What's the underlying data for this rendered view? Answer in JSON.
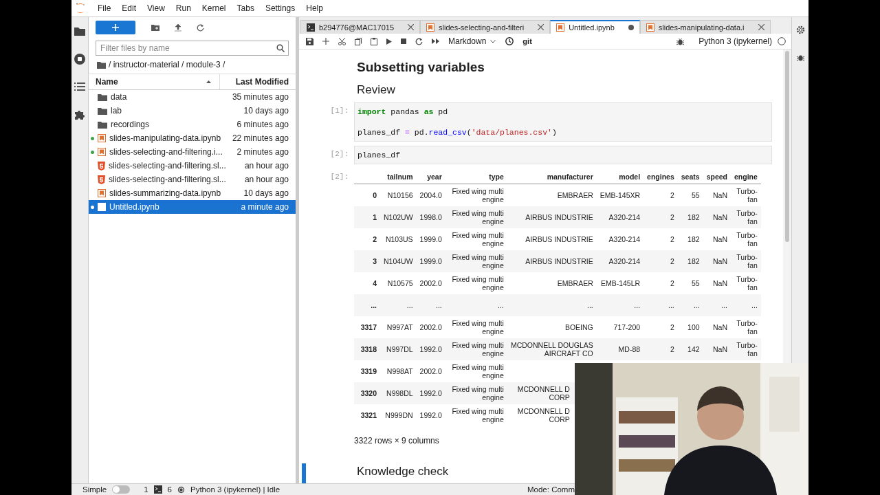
{
  "menu": [
    "File",
    "Edit",
    "View",
    "Run",
    "Kernel",
    "Tabs",
    "Settings",
    "Help"
  ],
  "file_browser": {
    "filter": {
      "placeholder": "Filter files by name"
    },
    "path": "/ instructor-material / module-3 /",
    "columns": [
      "Name",
      "Last Modified"
    ],
    "items": [
      {
        "name": "data",
        "modified": "35 minutes ago",
        "kind": "folder",
        "running": false,
        "selected": false
      },
      {
        "name": "lab",
        "modified": "10 days ago",
        "kind": "folder",
        "running": false,
        "selected": false
      },
      {
        "name": "recordings",
        "modified": "6 minutes ago",
        "kind": "folder",
        "running": false,
        "selected": false
      },
      {
        "name": "slides-manipulating-data.ipynb",
        "modified": "22 minutes ago",
        "kind": "notebook",
        "running": true,
        "selected": false
      },
      {
        "name": "slides-selecting-and-filtering.i...",
        "modified": "2 minutes ago",
        "kind": "notebook",
        "running": true,
        "selected": false
      },
      {
        "name": "slides-selecting-and-filtering.sl...",
        "modified": "an hour ago",
        "kind": "html",
        "running": false,
        "selected": false
      },
      {
        "name": "slides-selecting-and-filtering.sl...",
        "modified": "an hour ago",
        "kind": "html",
        "running": false,
        "selected": false
      },
      {
        "name": "slides-summarizing-data.ipynb",
        "modified": "10 days ago",
        "kind": "notebook",
        "running": false,
        "selected": false
      },
      {
        "name": "Untitled.ipynb",
        "modified": "a minute ago",
        "kind": "notebook",
        "running": true,
        "selected": true
      }
    ]
  },
  "tabs": [
    {
      "label": "b294776@MAC17015",
      "kind": "terminal",
      "selected": false,
      "modified": false
    },
    {
      "label": "slides-selecting-and-filteri",
      "kind": "notebook",
      "selected": false,
      "modified": false
    },
    {
      "label": "Untitled.ipynb",
      "kind": "notebook",
      "selected": true,
      "modified": true
    },
    {
      "label": "slides-manipulating-data.i",
      "kind": "notebook",
      "selected": false,
      "modified": false
    }
  ],
  "toolbar": {
    "cell_type": "Markdown",
    "git": "git",
    "kernel": "Python 3 (ipykernel)"
  },
  "notebook": {
    "cells": [
      {
        "kind": "heading1",
        "text": "Subsetting variables"
      },
      {
        "kind": "heading2",
        "text": "Review"
      },
      {
        "kind": "code",
        "prompt": "[1]:",
        "blocks": [
          {
            "lines": [
              {
                "tokens": [
                  {
                    "t": "import",
                    "kind": "keyword"
                  },
                  {
                    "t": " pandas ",
                    "kind": "plain"
                  },
                  {
                    "t": "as",
                    "kind": "keyword"
                  },
                  {
                    "t": " pd",
                    "kind": "plain"
                  }
                ]
              }
            ]
          },
          {
            "lines": [
              {
                "tokens": [
                  {
                    "t": "planes_df ",
                    "kind": "plain"
                  },
                  {
                    "t": "=",
                    "kind": "operator"
                  },
                  {
                    "t": " pd.",
                    "kind": "plain"
                  },
                  {
                    "t": "read_csv",
                    "kind": "function"
                  },
                  {
                    "t": "(",
                    "kind": "plain"
                  },
                  {
                    "t": "'data/planes.csv'",
                    "kind": "string"
                  },
                  {
                    "t": ")",
                    "kind": "plain"
                  }
                ]
              }
            ]
          }
        ]
      },
      {
        "kind": "code",
        "prompt": "[2]:",
        "blocks": [
          {
            "lines": [
              {
                "tokens": [
                  {
                    "t": "planes_df",
                    "kind": "plain"
                  }
                ]
              }
            ]
          }
        ]
      },
      {
        "kind": "output",
        "prompt": "[2]:",
        "table": {
          "columns": [
            "",
            "tailnum",
            "year",
            "type",
            "manufacturer",
            "model",
            "engines",
            "seats",
            "speed",
            "engine"
          ],
          "rows": [
            [
              "0",
              "N10156",
              "2004.0",
              "Fixed wing multi engine",
              "EMBRAER",
              "EMB-145XR",
              "2",
              "55",
              "NaN",
              "Turbo-fan"
            ],
            [
              "1",
              "N102UW",
              "1998.0",
              "Fixed wing multi engine",
              "AIRBUS INDUSTRIE",
              "A320-214",
              "2",
              "182",
              "NaN",
              "Turbo-fan"
            ],
            [
              "2",
              "N103US",
              "1999.0",
              "Fixed wing multi engine",
              "AIRBUS INDUSTRIE",
              "A320-214",
              "2",
              "182",
              "NaN",
              "Turbo-fan"
            ],
            [
              "3",
              "N104UW",
              "1999.0",
              "Fixed wing multi engine",
              "AIRBUS INDUSTRIE",
              "A320-214",
              "2",
              "182",
              "NaN",
              "Turbo-fan"
            ],
            [
              "4",
              "N10575",
              "2002.0",
              "Fixed wing multi engine",
              "EMBRAER",
              "EMB-145LR",
              "2",
              "55",
              "NaN",
              "Turbo-fan"
            ],
            [
              "...",
              "...",
              "...",
              "...",
              "...",
              "...",
              "...",
              "...",
              "...",
              "..."
            ],
            [
              "3317",
              "N997AT",
              "2002.0",
              "Fixed wing multi engine",
              "BOEING",
              "717-200",
              "2",
              "100",
              "NaN",
              "Turbo-fan"
            ],
            [
              "3318",
              "N997DL",
              "1992.0",
              "Fixed wing multi engine",
              "MCDONNELL DOUGLAS AIRCRAFT CO",
              "MD-88",
              "2",
              "142",
              "NaN",
              "Turbo-fan"
            ],
            [
              "3319",
              "N998AT",
              "2002.0",
              "Fixed wing multi engine"
            ],
            [
              "3320",
              "N998DL",
              "1992.0",
              "Fixed wing multi engine",
              {
                "lines": [
                  "MCDONNELL D",
                  "CORP"
                ]
              }
            ],
            [
              "3321",
              "N999DN",
              "1992.0",
              "Fixed wing multi engine",
              {
                "lines": [
                  "MCDONNELL D",
                  "CORP"
                ]
              }
            ]
          ]
        },
        "summary": "3322 rows × 9 columns"
      },
      {
        "kind": "heading2",
        "text": "Knowledge check",
        "active": true
      }
    ]
  },
  "status_bar": {
    "mode_label": "Simple",
    "simple_on": false,
    "terminals": "1",
    "kernels": "6",
    "kernel_status": "Python 3 (ipykernel) | Idle",
    "mode": "Mode: Comm"
  },
  "webcam": {
    "kind": "picture"
  }
}
